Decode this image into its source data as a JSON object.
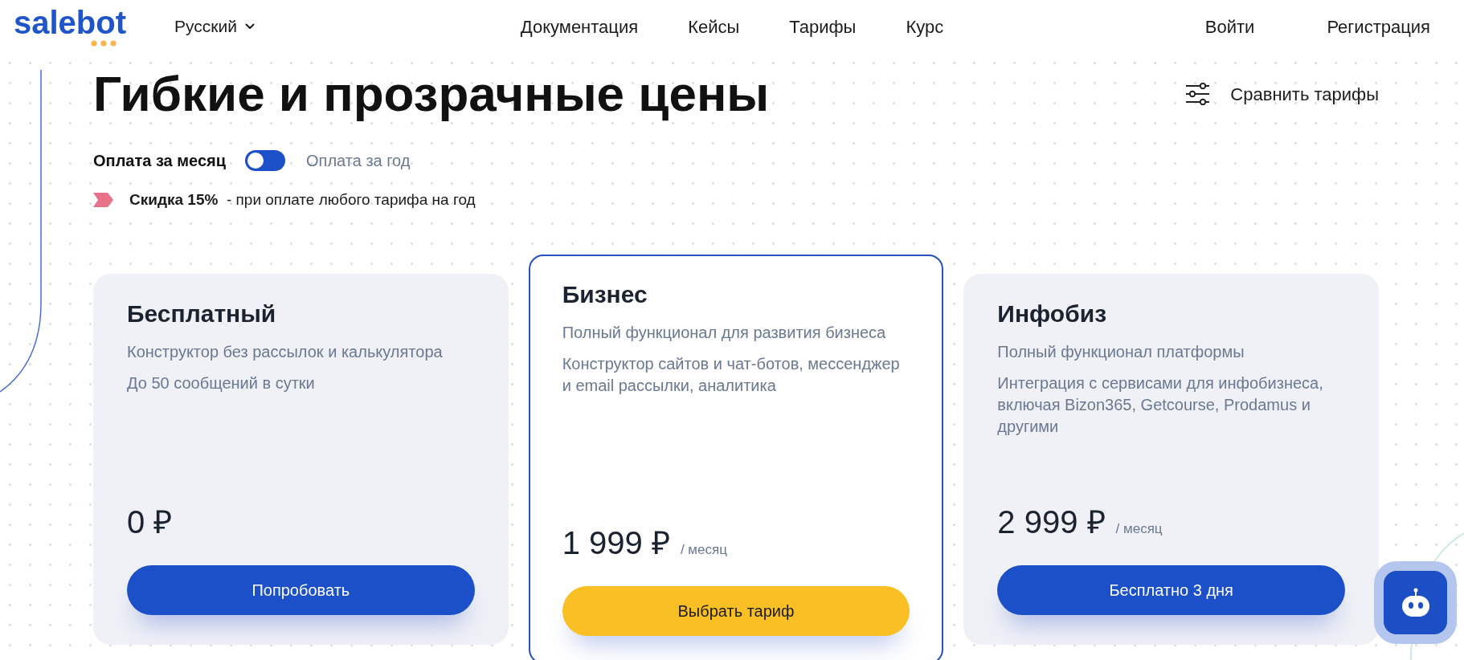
{
  "header": {
    "logo": "salebot",
    "language": "Русский",
    "nav": [
      "Документация",
      "Кейсы",
      "Тарифы",
      "Курс"
    ],
    "auth": [
      "Войти",
      "Регистрация"
    ]
  },
  "title": "Гибкие и прозрачные цены",
  "compare_link": "Сравнить тарифы",
  "billing": {
    "monthly_label": "Оплата за месяц",
    "yearly_label": "Оплата за год",
    "yearly": false
  },
  "discount": "**Скидка 15%**  - при оплате любого тарифа на год",
  "plans": [
    {
      "name": "Бесплатный",
      "highlighted": false,
      "descriptions": [
        "Конструктор без рассылок и калькулятора",
        "До 50 сообщений в сутки"
      ],
      "price": "0 ₽",
      "button": {
        "label": "Попробовать",
        "kind": "primary"
      }
    },
    {
      "name": "Бизнес",
      "highlighted": true,
      "descriptions": [
        "Полный функционал для развития бизнеса",
        "Конструктор сайтов и чат-ботов, мессенджер и email рассылки, аналитика"
      ],
      "price": "1 999 ₽",
      "period": "/ месяц",
      "button": {
        "label": "Выбрать тариф",
        "kind": "accent"
      }
    },
    {
      "name": "Инфобиз",
      "highlighted": false,
      "descriptions": [
        "Полный функционал платформы",
        "Интеграция с сервисами для инфобизнеса, включая Bizon365, Getcourse, Prodamus и другими"
      ],
      "price": "2 999 ₽",
      "period": "/ месяц",
      "button": {
        "label": "Бесплатно 3 дня",
        "kind": "primary"
      }
    }
  ]
}
